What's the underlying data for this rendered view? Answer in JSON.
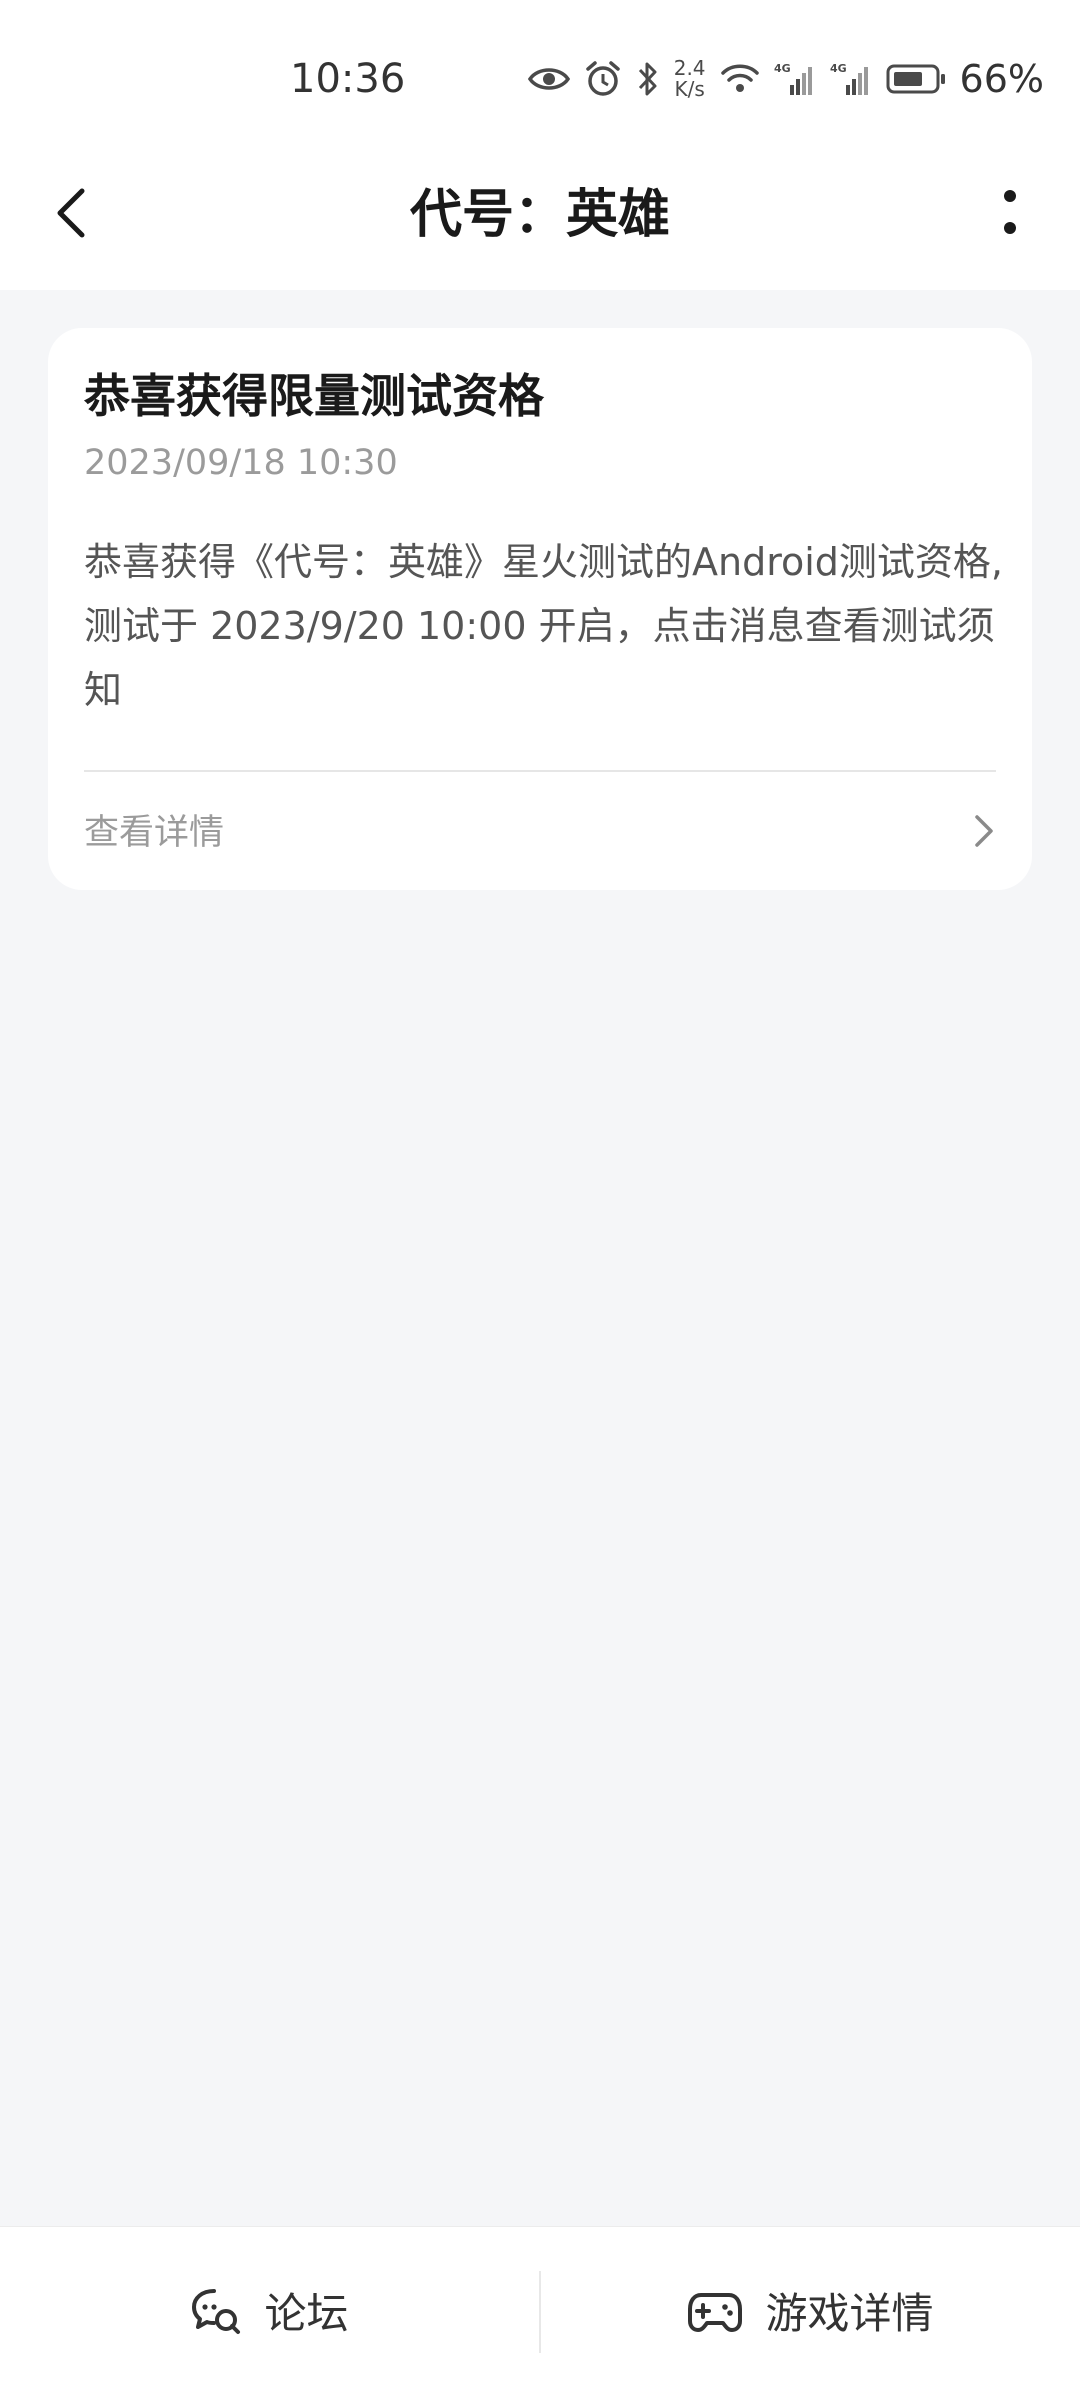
{
  "status_bar": {
    "time": "10:36",
    "net_speed_value": "2.4",
    "net_speed_unit": "K/s",
    "signal_1_label": "4G",
    "signal_2_label": "4G",
    "battery": "66%",
    "icons": [
      "eye-icon",
      "alarm-icon",
      "bluetooth-icon",
      "wifi-icon",
      "signal-icon",
      "battery-icon"
    ]
  },
  "header": {
    "title": "代号：英雄",
    "back_icon": "chevron-left-icon",
    "more_icon": "more-vertical-icon"
  },
  "message": {
    "title": "恭喜获得限量测试资格",
    "time": "2023/09/18 10:30",
    "body": "恭喜获得《代号：英雄》星火测试的Android测试资格,测试于 2023/9/20 10:00 开启，点击消息查看测试须知",
    "detail_label": "查看详情",
    "detail_icon": "chevron-right-icon"
  },
  "bottom_bar": {
    "forum_label": "论坛",
    "forum_icon": "forum-chat-icon",
    "game_detail_label": "游戏详情",
    "game_detail_icon": "gamepad-icon"
  },
  "colors": {
    "page_background": "#f5f6f8",
    "card_background": "#ffffff",
    "secondary_text": "#9b9b9b",
    "body_text": "#555555"
  }
}
